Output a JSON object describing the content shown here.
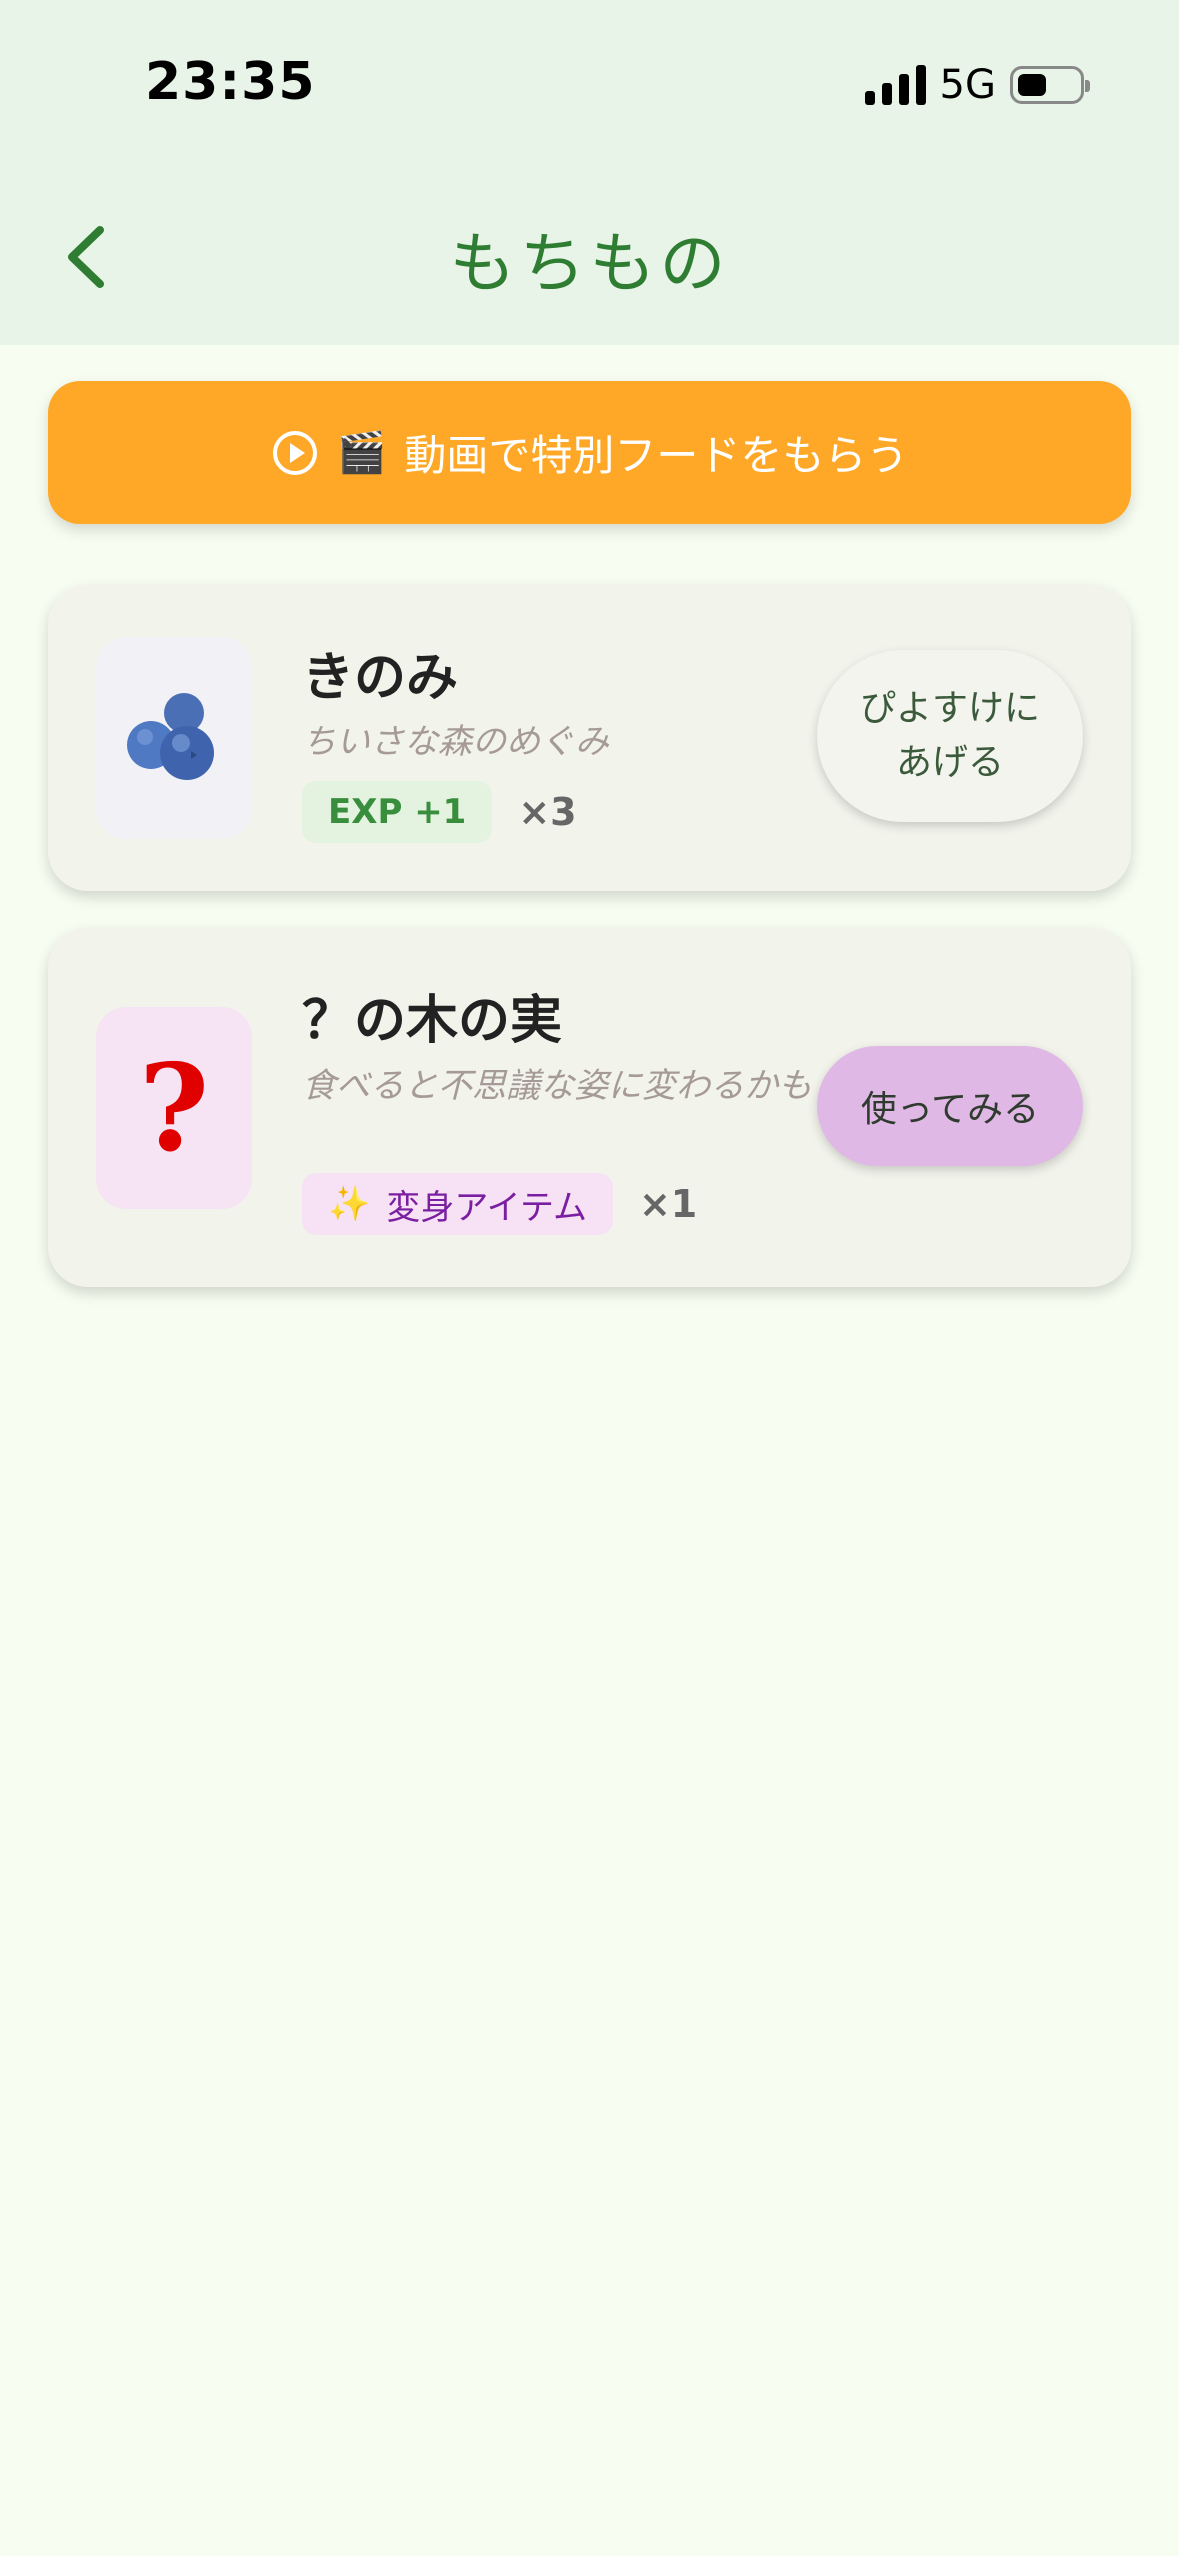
{
  "status_bar": {
    "time": "23:35",
    "network": "5G"
  },
  "header": {
    "title": "もちもの"
  },
  "video_button": {
    "label": "動画で特別フードをもらう",
    "emoji": "🎬"
  },
  "items": [
    {
      "name": "きのみ",
      "description": "ちいさな森のめぐみ",
      "tag": "EXP +1",
      "count": "×3",
      "action": "ぴよすけに\nあげる"
    },
    {
      "name": "？の木の実",
      "description": "食べると不思議な姿に変わるかも",
      "tag_icon": "✨",
      "tag": "変身アイテム",
      "count": "×1",
      "action": "使ってみる",
      "thumb_symbol": "?"
    }
  ],
  "colors": {
    "header_bg": "#e8f4e8",
    "title": "#2e7d32",
    "video_button": "#ffa726",
    "use_button": "#e0b8e6",
    "question_mark": "#e00000"
  }
}
